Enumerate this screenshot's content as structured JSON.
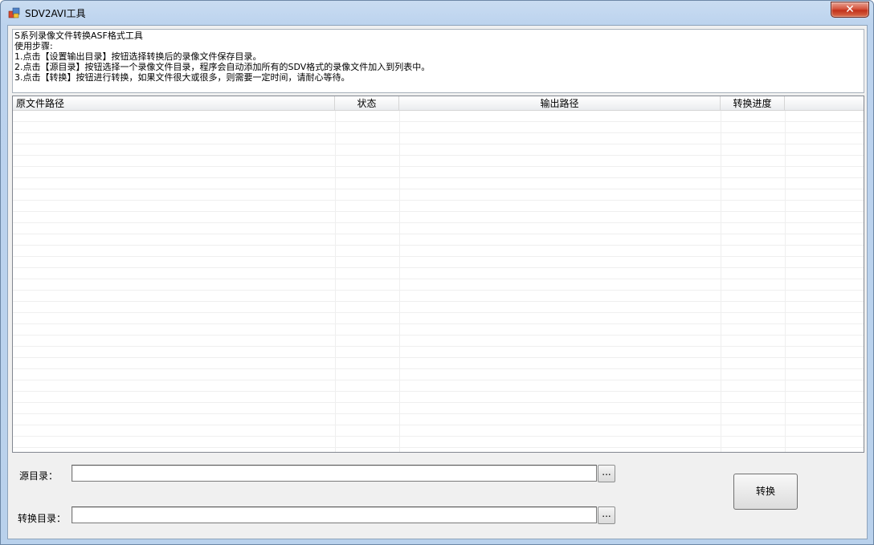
{
  "window": {
    "title": "SDV2AVI工具",
    "close_glyph": "✕"
  },
  "instructions": {
    "lines": [
      "S系列录像文件转换ASF格式工具",
      "使用步骤:",
      "1.点击【设置输出目录】按钮选择转换后的录像文件保存目录。",
      "2.点击【源目录】按钮选择一个录像文件目录，程序会自动添加所有的SDV格式的录像文件加入到列表中。",
      "3.点击【转换】按钮进行转换，如果文件很大或很多，则需要一定时间，请耐心等待。"
    ]
  },
  "file_list": {
    "columns": [
      "原文件路径",
      "状态",
      "输出路径",
      "转换进度"
    ],
    "rows": []
  },
  "source_dir": {
    "label": "源目录：",
    "value": "",
    "browse_label": "..."
  },
  "convert_dir": {
    "label": "转换目录：",
    "value": "",
    "browse_label": "..."
  },
  "actions": {
    "convert_label": "转换"
  }
}
